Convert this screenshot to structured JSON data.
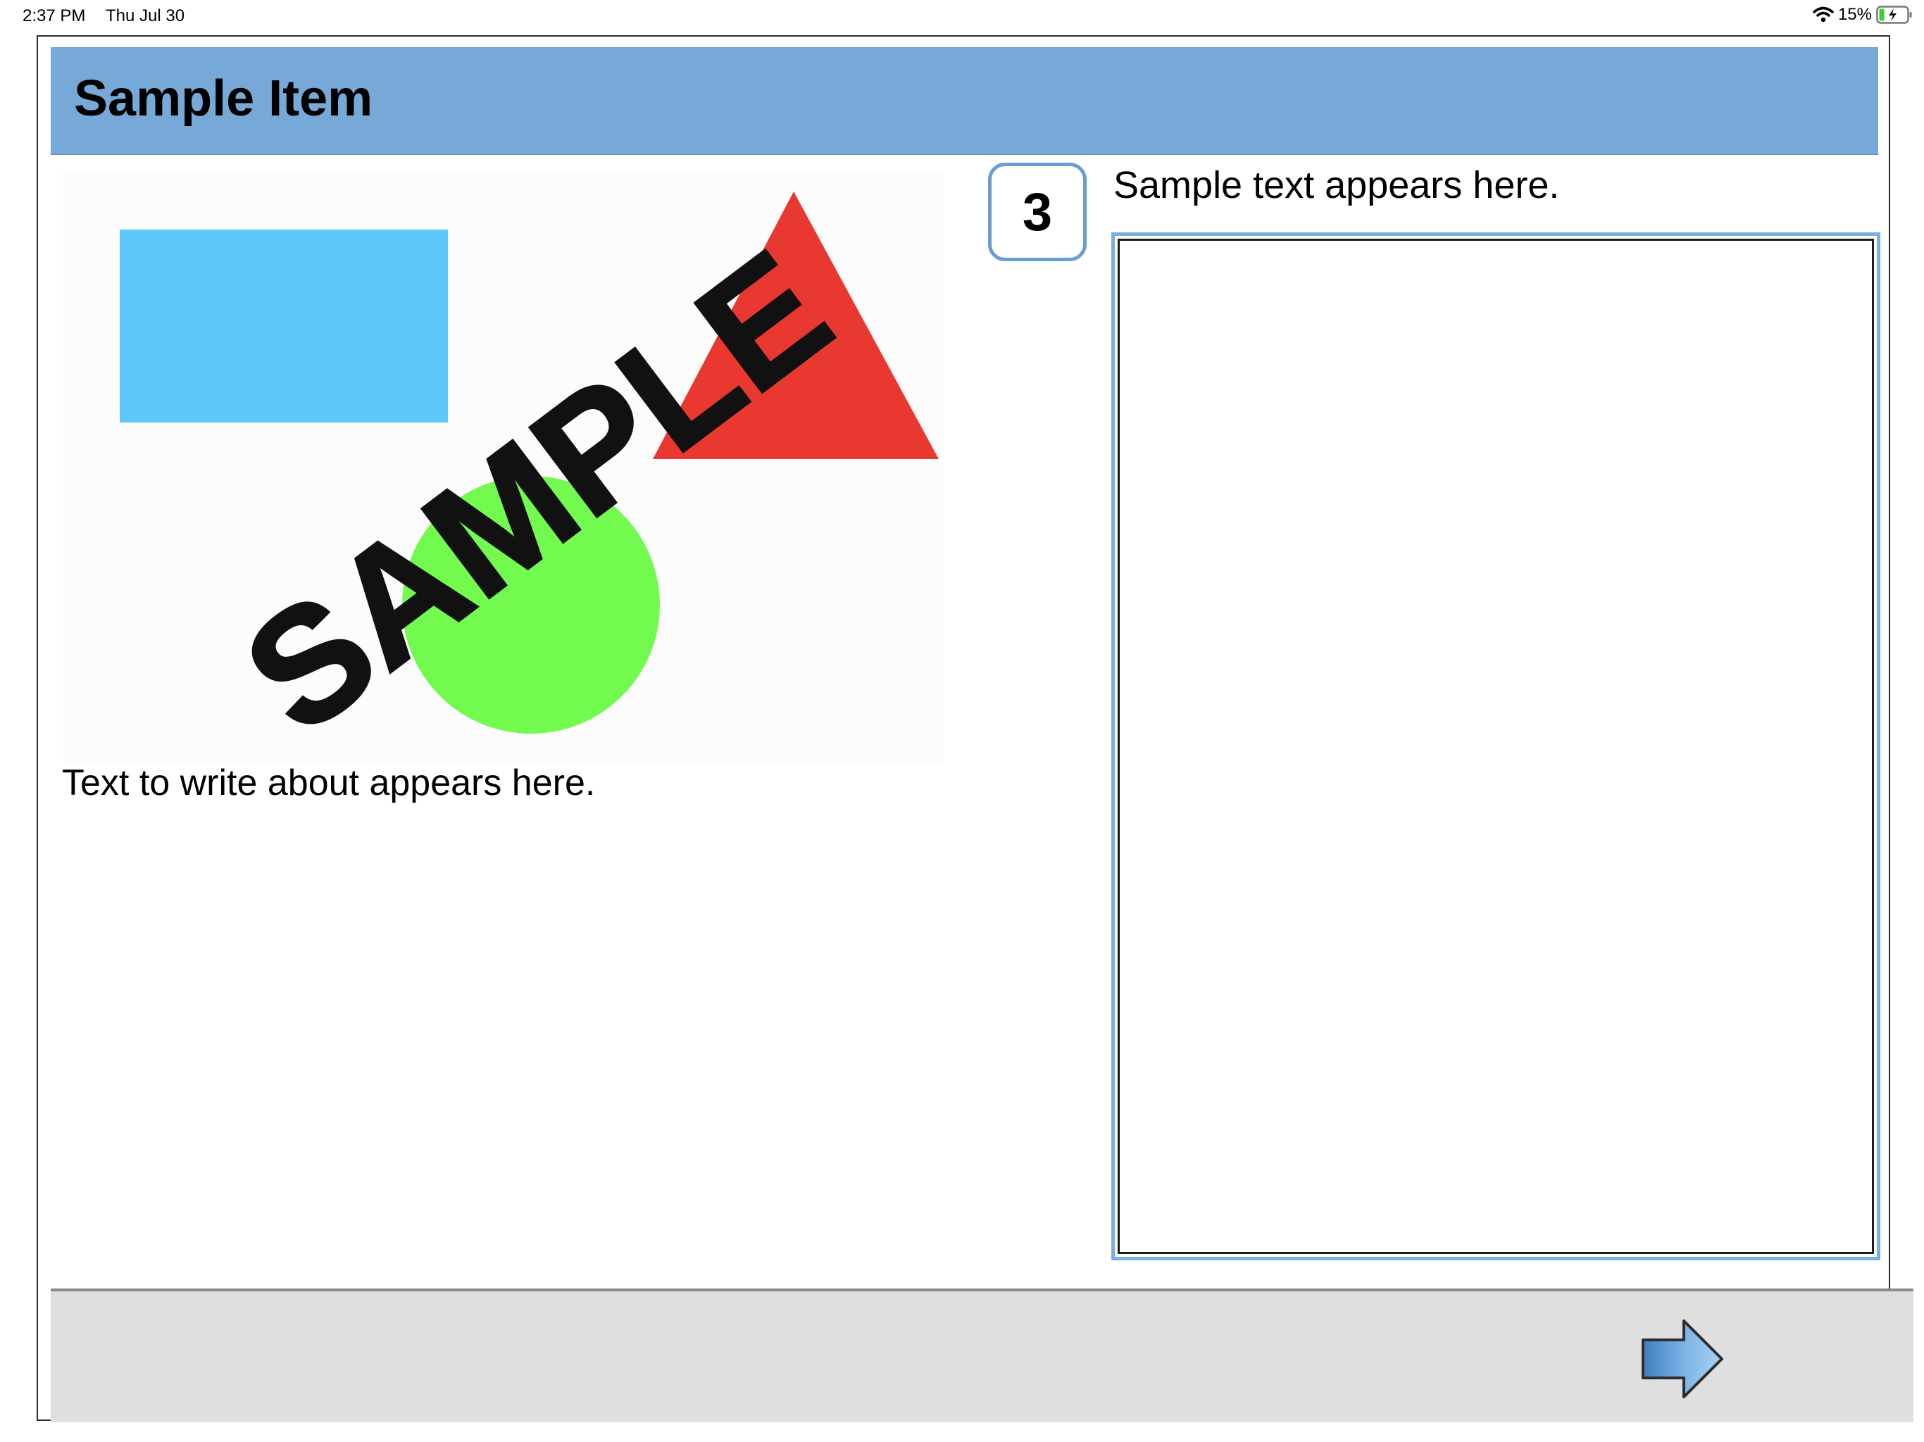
{
  "status_bar": {
    "time": "2:37 PM",
    "date": "Thu Jul 30",
    "battery_percent": "15%",
    "icons": [
      "wifi-icon",
      "battery-charging-icon"
    ]
  },
  "header": {
    "title": "Sample Item"
  },
  "stimulus": {
    "watermark": "SAMPLE",
    "shapes": [
      "blue-rectangle",
      "red-triangle",
      "green-circle"
    ],
    "colors": {
      "rectangle": "#5ec8fa",
      "triangle": "#e83830",
      "circle": "#73fa4f"
    },
    "text": "Text to write about appears here."
  },
  "question": {
    "number": "3",
    "prompt": "Sample text appears here."
  },
  "response": {
    "value": ""
  },
  "footer": {
    "next_icon": "arrow-right-icon"
  },
  "colors": {
    "header_bg": "#76a9d8",
    "accent_border": "#6b9cd2",
    "footer_bg": "#dfdfdf"
  }
}
